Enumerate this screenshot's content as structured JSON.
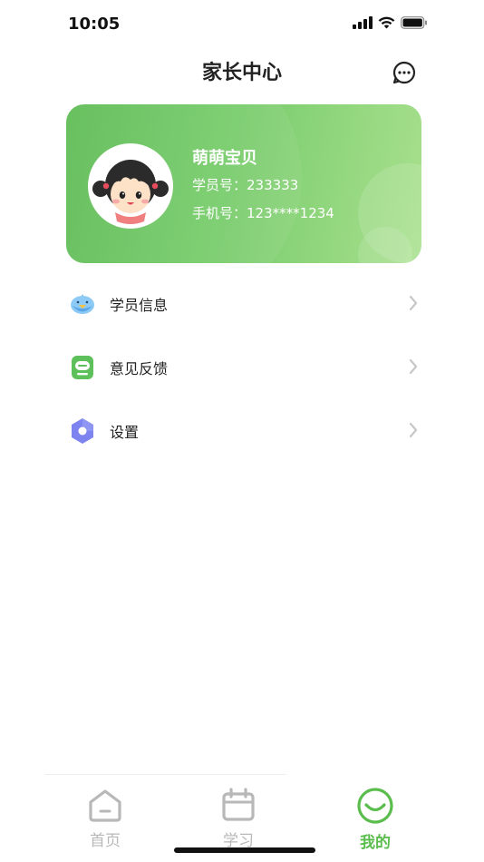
{
  "status_bar": {
    "time": "10:05"
  },
  "nav": {
    "title": "家长中心"
  },
  "profile": {
    "name": "萌萌宝贝",
    "student_id_label": "学员号：",
    "student_id": "233333",
    "phone_label": "手机号：",
    "phone": "123****1234"
  },
  "menu": [
    {
      "label": "学员信息",
      "icon": "bird-icon"
    },
    {
      "label": "意见反馈",
      "icon": "feedback-icon"
    },
    {
      "label": "设置",
      "icon": "settings-icon"
    }
  ],
  "tabs": [
    {
      "label": "首页",
      "icon": "home-icon",
      "active": false
    },
    {
      "label": "学习",
      "icon": "calendar-icon",
      "active": false
    },
    {
      "label": "我的",
      "icon": "smile-icon",
      "active": true
    }
  ],
  "colors": {
    "accent": "#5bbd4e",
    "card_gradient_start": "#5fbd56",
    "card_gradient_end": "#a9e08e",
    "inactive_tab": "#b8b8b8"
  }
}
